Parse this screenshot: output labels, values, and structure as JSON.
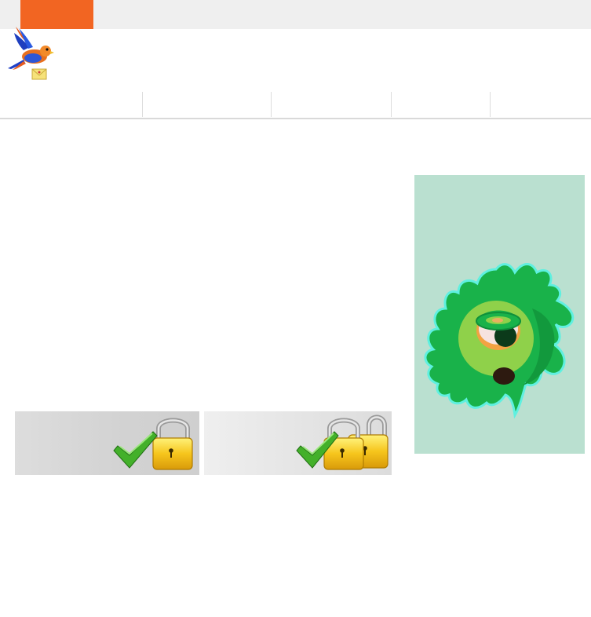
{
  "header": {
    "tab_color": "#f26522",
    "logo_icon": "parrot-mail-logo-icon"
  },
  "nav": {
    "items": [
      "",
      "",
      "",
      "",
      ""
    ]
  },
  "promos": [
    {
      "icon": "check-lock-icon",
      "label": ""
    },
    {
      "icon": "check-double-lock-icon",
      "label": ""
    }
  ],
  "ad": {
    "icon": "green-virus-monster-icon",
    "background": "#bae0d0"
  }
}
